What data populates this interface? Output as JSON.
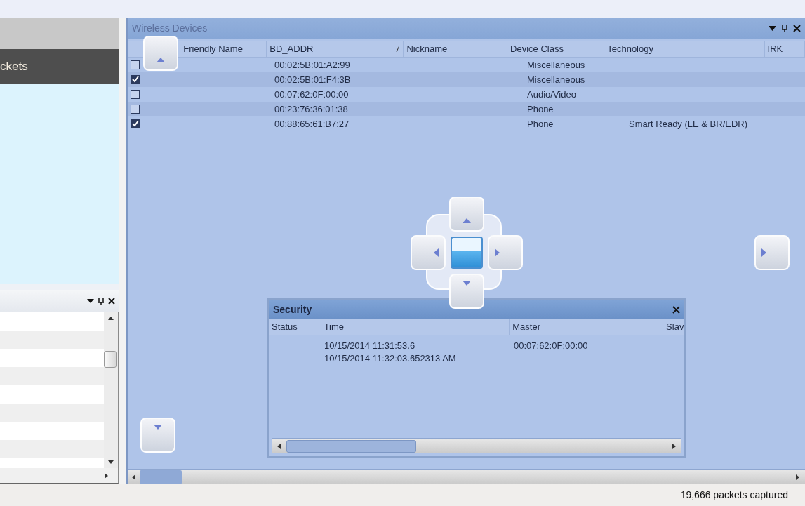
{
  "left_panel": {
    "header_text": "ckets"
  },
  "wireless_devices": {
    "title": "Wireless Devices",
    "columns": [
      "Friendly Name",
      "BD_ADDR",
      "Nickname",
      "Device Class",
      "Technology",
      "IRK"
    ],
    "rows": [
      {
        "checked": false,
        "bd_addr": "00:02:5B:01:A2:99",
        "device_class": "Miscellaneous",
        "technology": ""
      },
      {
        "checked": true,
        "bd_addr": "00:02:5B:01:F4:3B",
        "device_class": "Miscellaneous",
        "technology": ""
      },
      {
        "checked": false,
        "bd_addr": "00:07:62:0F:00:00",
        "device_class": "Audio/Video",
        "technology": ""
      },
      {
        "checked": false,
        "bd_addr": "00:23:76:36:01:38",
        "device_class": "Phone",
        "technology": ""
      },
      {
        "checked": true,
        "bd_addr": "00:88:65:61:B7:27",
        "device_class": "Phone",
        "technology": "Smart Ready (LE & BR/EDR)"
      }
    ]
  },
  "security": {
    "title": "Security",
    "columns": [
      "Status",
      "Time",
      "Master",
      "Slav"
    ],
    "rows": [
      {
        "time": "10/15/2014 11:31:53.6",
        "master": "00:07:62:0F:00:00"
      },
      {
        "time": "10/15/2014 11:32:03.652313 AM",
        "master": ""
      }
    ]
  },
  "status_bar": {
    "text": "19,666 packets captured"
  }
}
